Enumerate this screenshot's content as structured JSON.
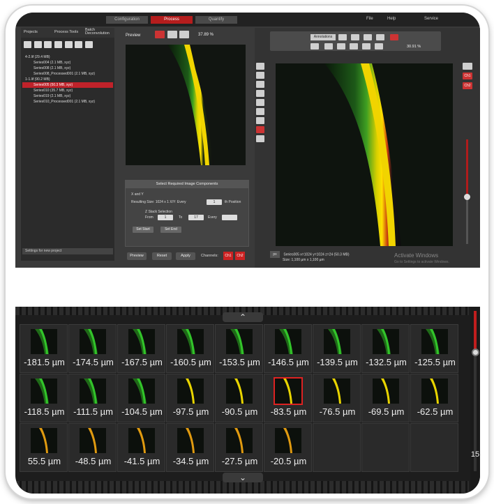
{
  "menubar": {
    "steps": [
      "Configuration",
      "Process",
      "Quantify"
    ],
    "active_step": "Process",
    "items": [
      "File",
      "Help",
      "Service"
    ]
  },
  "left_panel": {
    "tabs": [
      "Projects",
      "Process Tools",
      "Batch Deconvolution"
    ],
    "tree": [
      {
        "label": "4-2.lif   (29.4 MB)",
        "level": 0,
        "selected": false
      },
      {
        "label": "Series004   (2.1 MB, xyz)",
        "level": 1,
        "selected": false
      },
      {
        "label": "Series008   (2.1 MB, xyz)",
        "level": 1,
        "selected": false
      },
      {
        "label": "Series008_Processed001   (2.1 MB, xyz)",
        "level": 1,
        "selected": false
      },
      {
        "label": "1-1.lif   (90.2 MB)",
        "level": 0,
        "selected": false
      },
      {
        "label": "Series005   (50.3 MB, xyz)",
        "level": 1,
        "selected": true
      },
      {
        "label": "Series010   (35.7 MB, xyz)",
        "level": 1,
        "selected": false
      },
      {
        "label": "Series019   (2.1 MB, xyz)",
        "level": 1,
        "selected": false
      },
      {
        "label": "Series010_Processed001   (2.1 MB, xyz)",
        "level": 1,
        "selected": false
      }
    ],
    "settings_label": "Settings for new project"
  },
  "preview": {
    "label": "Preview",
    "zoom": "37.89 %"
  },
  "selection_panel": {
    "title": "Select Required Image Components",
    "xy_label": "X and Y",
    "resulting_size": "Resulting Size:  1024 x 1 X/Y: Every",
    "every_value": "1",
    "position_label": "th Position",
    "z_label": "Z Stack Selection",
    "from_label": "From",
    "from_value": "1",
    "to_label": "To",
    "to_value": "17",
    "every_label": "Every",
    "set_start": "Set Start",
    "set_end": "Set End"
  },
  "bottom_buttons": {
    "preview": "Preview",
    "reset": "Reset",
    "apply": "Apply",
    "channels_label": "Channels:",
    "ch1": "Ch1",
    "ch2": "Ch2"
  },
  "viewer": {
    "annotations_label": "Annotations",
    "zoom": "30.91 %",
    "status_line1": "Series005  x=1024  y=1024  z=24  (50.3 MB)",
    "status_line2": "Size: 1,100 µm x 1,100 µm",
    "px_label": "px",
    "side_ch1": "Ch1",
    "side_ch2": "Ch2",
    "watermark": "Activate Windows",
    "watermark_sub": "Go to Settings to activate Windows."
  },
  "filmstrip": {
    "thumbs": [
      {
        "label": "-181.5 µm",
        "color": "green",
        "selected": false
      },
      {
        "label": "-174.5 µm",
        "color": "green",
        "selected": false
      },
      {
        "label": "-167.5 µm",
        "color": "green",
        "selected": false
      },
      {
        "label": "-160.5 µm",
        "color": "green",
        "selected": false
      },
      {
        "label": "-153.5 µm",
        "color": "green",
        "selected": false
      },
      {
        "label": "-146.5 µm",
        "color": "green",
        "selected": false
      },
      {
        "label": "-139.5 µm",
        "color": "green",
        "selected": false
      },
      {
        "label": "-132.5 µm",
        "color": "green",
        "selected": false
      },
      {
        "label": "-125.5 µm",
        "color": "green",
        "selected": false
      },
      {
        "label": "-118.5 µm",
        "color": "green",
        "selected": false
      },
      {
        "label": "-111.5 µm",
        "color": "green",
        "selected": false
      },
      {
        "label": "-104.5 µm",
        "color": "green",
        "selected": false
      },
      {
        "label": "-97.5 µm",
        "color": "yellow",
        "selected": false
      },
      {
        "label": "-90.5 µm",
        "color": "yellow",
        "selected": false
      },
      {
        "label": "-83.5 µm",
        "color": "yellow",
        "selected": true
      },
      {
        "label": "-76.5 µm",
        "color": "yellow",
        "selected": false
      },
      {
        "label": "-69.5 µm",
        "color": "yellow",
        "selected": false
      },
      {
        "label": "-62.5 µm",
        "color": "yellow",
        "selected": false
      },
      {
        "label": "55.5 µm",
        "color": "orange",
        "selected": false
      },
      {
        "label": "-48.5 µm",
        "color": "orange",
        "selected": false
      },
      {
        "label": "-41.5 µm",
        "color": "orange",
        "selected": false
      },
      {
        "label": "-34.5 µm",
        "color": "orange",
        "selected": false
      },
      {
        "label": "-27.5 µm",
        "color": "orange",
        "selected": false
      },
      {
        "label": "-20.5 µm",
        "color": "orange",
        "selected": false
      }
    ],
    "scroll_number": "15"
  },
  "colors": {
    "accent_red": "#c01e1e",
    "panel_dark": "#2b2b2b",
    "background": "#3a3a3a"
  }
}
